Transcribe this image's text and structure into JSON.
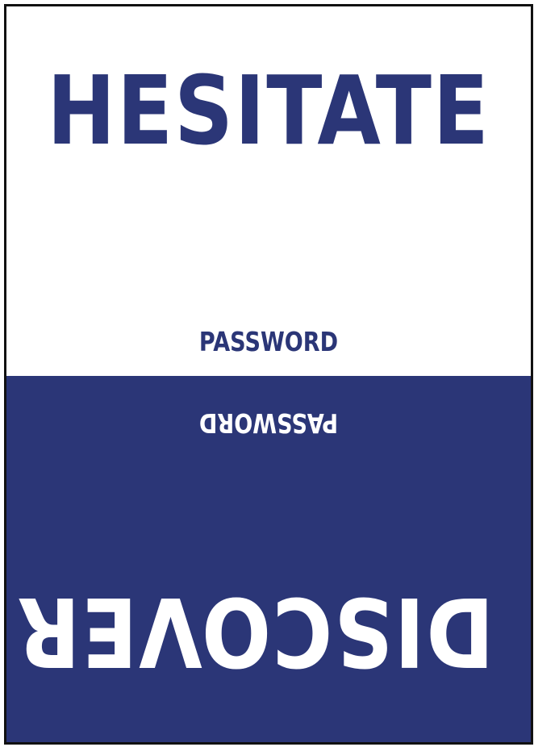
{
  "card": {
    "top_word": "HESITATE",
    "top_label": "PASSWORD",
    "bottom_label": "PASSWORD",
    "bottom_word": "DISCOVER"
  },
  "colors": {
    "navy": "#2b3677",
    "white": "#ffffff",
    "border": "#111111"
  }
}
